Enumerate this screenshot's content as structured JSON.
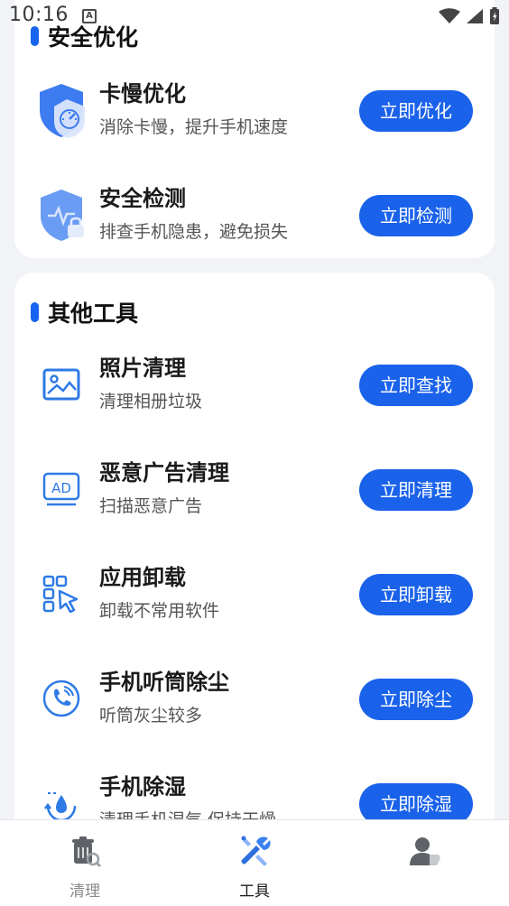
{
  "status_bar": {
    "time": "10:16",
    "indicator": "A"
  },
  "security_section": {
    "title": "安全优化",
    "items": [
      {
        "title": "卡慢优化",
        "desc": "消除卡慢，提升手机速度",
        "button": "立即优化",
        "icon": "shield-speed-icon"
      },
      {
        "title": "安全检测",
        "desc": "排查手机隐患，避免损失",
        "button": "立即检测",
        "icon": "shield-check-icon"
      }
    ]
  },
  "tools_section": {
    "title": "其他工具",
    "items": [
      {
        "title": "照片清理",
        "desc": "清理相册垃圾",
        "button": "立即查找",
        "icon": "photo-icon"
      },
      {
        "title": "恶意广告清理",
        "desc": "扫描恶意广告",
        "button": "立即清理",
        "icon": "ad-icon"
      },
      {
        "title": "应用卸载",
        "desc": "卸载不常用软件",
        "button": "立即卸载",
        "icon": "app-uninstall-icon"
      },
      {
        "title": "手机听筒除尘",
        "desc": "听筒灰尘较多",
        "button": "立即除尘",
        "icon": "earpiece-icon"
      },
      {
        "title": "手机除湿",
        "desc": "清理手机湿气,保持干燥",
        "button": "立即除湿",
        "icon": "water-drop-icon"
      }
    ]
  },
  "bottom_nav": {
    "items": [
      {
        "label": "清理",
        "icon": "trash-icon",
        "active": false
      },
      {
        "label": "工具",
        "icon": "tools-icon",
        "active": true
      },
      {
        "label": "",
        "icon": "user-icon",
        "active": false
      }
    ]
  },
  "colors": {
    "accent": "#1a62ea",
    "background": "#f1f3f7",
    "card": "#ffffff"
  }
}
